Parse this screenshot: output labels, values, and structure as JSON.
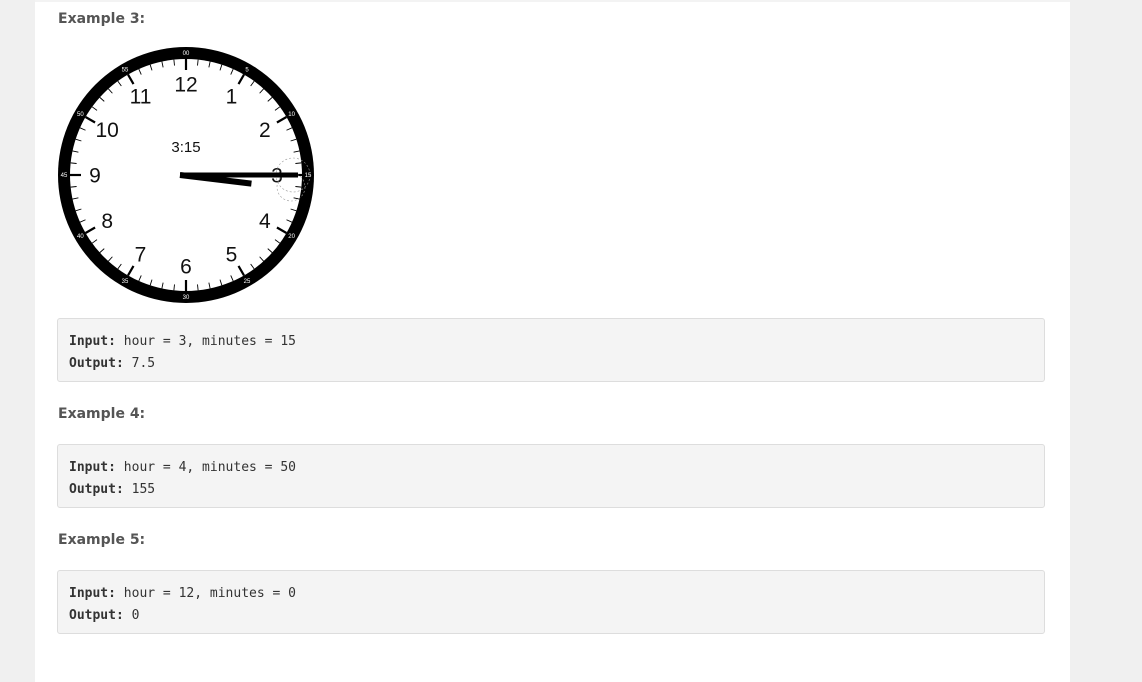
{
  "examples": [
    {
      "heading": "Example 3:",
      "input_label": "Input:",
      "input_value": " hour = 3, minutes = 15",
      "output_label": "Output:",
      "output_value": " 7.5",
      "clock": {
        "time_label": "3:15",
        "hour": 3,
        "minutes": 15,
        "hour_numbers": [
          "12",
          "1",
          "2",
          "3",
          "4",
          "5",
          "6",
          "7",
          "8",
          "9",
          "10",
          "11"
        ],
        "minute_labels": [
          "00",
          "5",
          "10",
          "15",
          "20",
          "25",
          "30",
          "35",
          "40",
          "45",
          "50",
          "55"
        ]
      }
    },
    {
      "heading": "Example 4:",
      "input_label": "Input:",
      "input_value": " hour = 4, minutes = 50",
      "output_label": "Output:",
      "output_value": " 155"
    },
    {
      "heading": "Example 5:",
      "input_label": "Input:",
      "input_value": " hour = 12, minutes = 0",
      "output_label": "Output:",
      "output_value": " 0"
    }
  ]
}
